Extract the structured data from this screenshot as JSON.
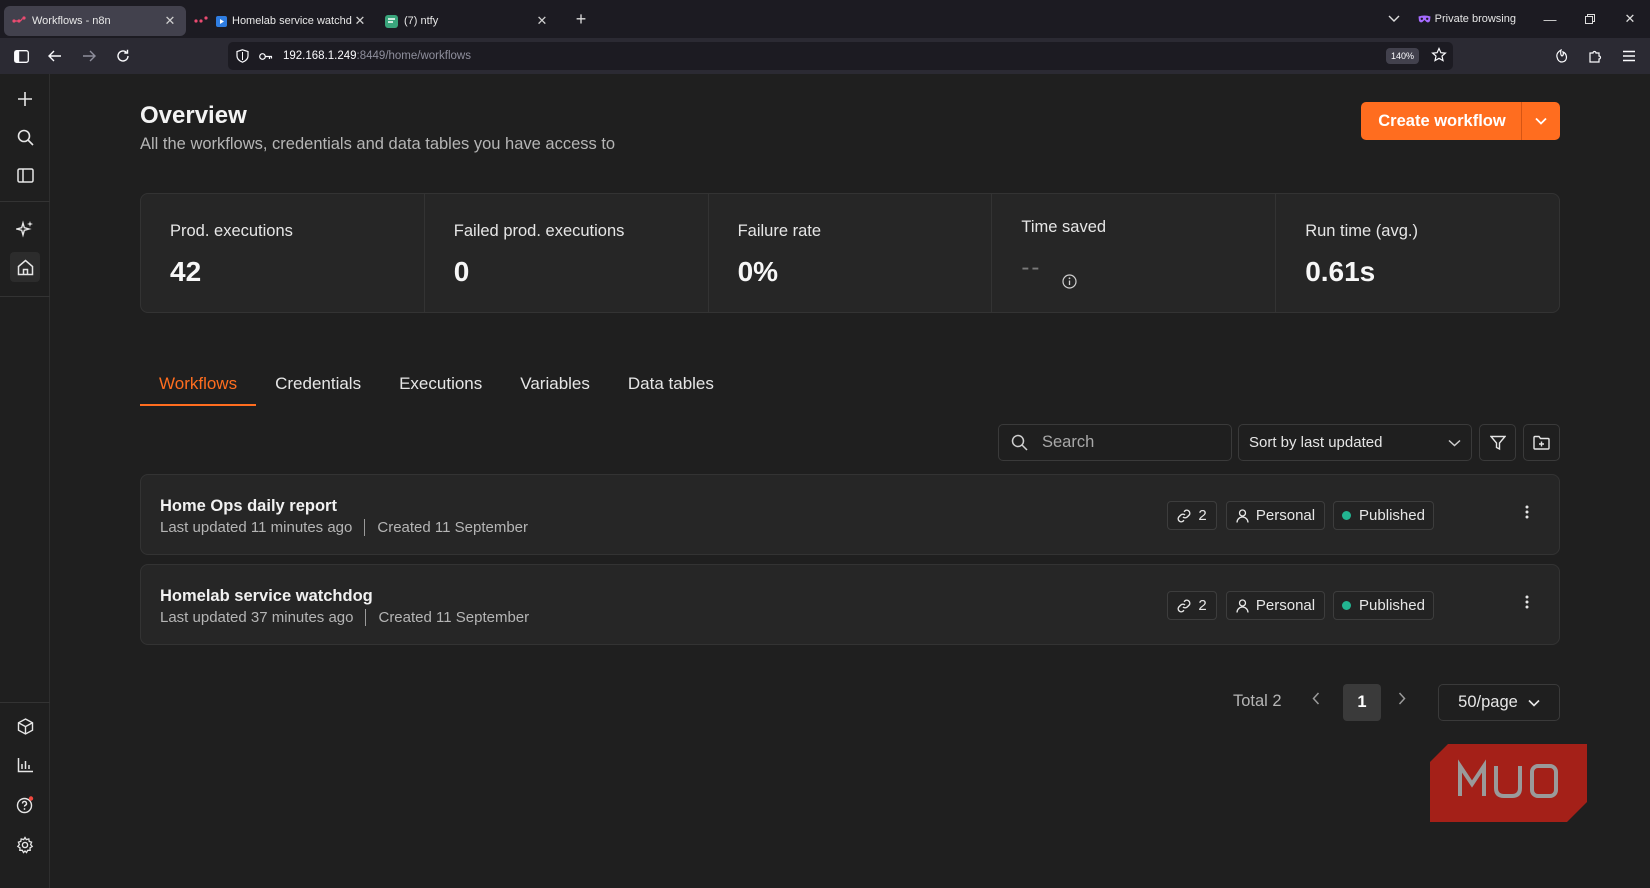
{
  "browser": {
    "tabs": [
      {
        "title": "Workflows - n8n",
        "active": true
      },
      {
        "title": "Homelab service watchdog",
        "active": false
      },
      {
        "title": "(7) ntfy",
        "active": false
      }
    ],
    "private_label": "Private browsing",
    "url_host": "192.168.1.249",
    "url_rest": ":8449/home/workflows",
    "zoom": "140%"
  },
  "page": {
    "title": "Overview",
    "subtitle": "All the workflows, credentials and data tables you have access to",
    "create_label": "Create workflow"
  },
  "stats": [
    {
      "label": "Prod. executions",
      "value": "42"
    },
    {
      "label": "Failed prod. executions",
      "value": "0"
    },
    {
      "label": "Failure rate",
      "value": "0%"
    },
    {
      "label": "Time saved",
      "value": "--"
    },
    {
      "label": "Run time (avg.)",
      "value": "0.61s"
    }
  ],
  "tabs": [
    "Workflows",
    "Credentials",
    "Executions",
    "Variables",
    "Data tables"
  ],
  "search": {
    "placeholder": "Search"
  },
  "sort": {
    "label": "Sort by last updated"
  },
  "workflows": [
    {
      "name": "Home Ops daily report",
      "updated": "Last updated 11 minutes ago",
      "created": "Created 11 September",
      "links": "2",
      "owner": "Personal",
      "status": "Published"
    },
    {
      "name": "Homelab service watchdog",
      "updated": "Last updated 37 minutes ago",
      "created": "Created 11 September",
      "links": "2",
      "owner": "Personal",
      "status": "Published"
    }
  ],
  "pagination": {
    "total": "Total 2",
    "current": "1",
    "per_page": "50/page"
  },
  "colors": {
    "accent": "#ff6d1f",
    "published": "#22b390",
    "background": "#1f1f1f"
  },
  "watermark": "MUO"
}
